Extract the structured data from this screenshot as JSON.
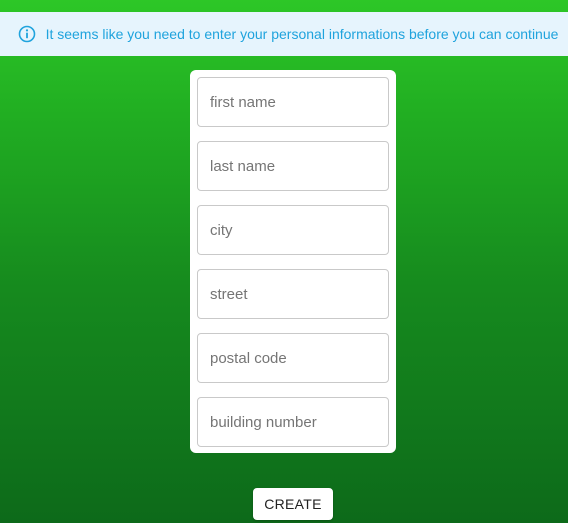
{
  "banner": {
    "icon": "info-icon",
    "message": "It seems like you need to enter your personal informations before you can continue"
  },
  "form": {
    "fields": [
      {
        "placeholder": "first name",
        "value": ""
      },
      {
        "placeholder": "last name",
        "value": ""
      },
      {
        "placeholder": "city",
        "value": ""
      },
      {
        "placeholder": "street",
        "value": ""
      },
      {
        "placeholder": "postal code",
        "value": ""
      },
      {
        "placeholder": "building number",
        "value": ""
      }
    ],
    "submit_label": "CREATE"
  },
  "colors": {
    "banner_background": "#e6f4fd",
    "banner_text": "#1fa3dd",
    "background_top": "#2dc727",
    "background_bottom": "#0d6a1a"
  }
}
